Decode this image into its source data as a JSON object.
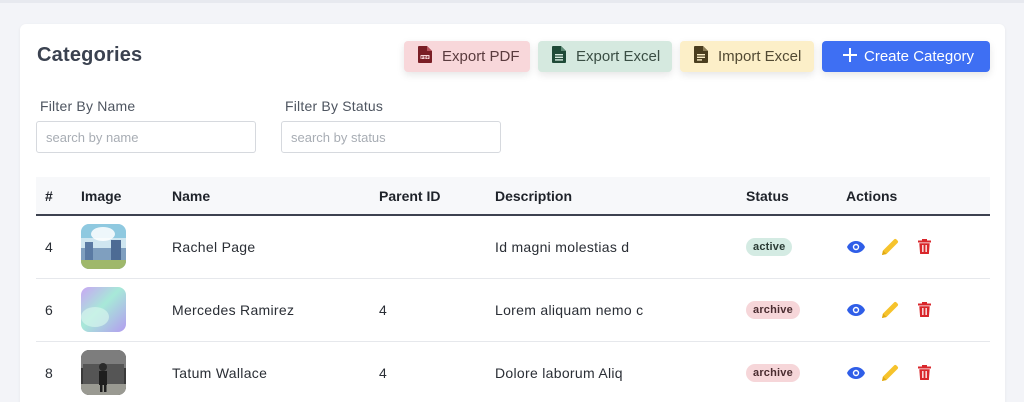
{
  "header": {
    "title": "Categories",
    "buttons": {
      "export_pdf": "Export PDF",
      "export_excel": "Export Excel",
      "import_excel": "Import Excel",
      "create": "Create Category"
    }
  },
  "filters": {
    "name": {
      "label": "Filter By Name",
      "placeholder": "search by name",
      "value": ""
    },
    "status": {
      "label": "Filter By Status",
      "placeholder": "search by status",
      "value": ""
    }
  },
  "table": {
    "columns": [
      "#",
      "Image",
      "Name",
      "Parent ID",
      "Description",
      "Status",
      "Actions"
    ],
    "rows": [
      {
        "id": "4",
        "image": "landscape-thumbnail",
        "name": "Rachel Page",
        "parent_id": "",
        "description": "Id magni molestias d",
        "status": "active"
      },
      {
        "id": "6",
        "image": "gradient-thumbnail",
        "name": "Mercedes Ramirez",
        "parent_id": "4",
        "description": "Lorem aliquam nemo c",
        "status": "archive"
      },
      {
        "id": "8",
        "image": "person-photo-thumbnail",
        "name": "Tatum Wallace",
        "parent_id": "4",
        "description": "Dolore laborum Aliq",
        "status": "archive"
      }
    ]
  },
  "colors": {
    "primary": "#3e6ff3",
    "view_icon": "#2f5ee8",
    "edit_icon": "#f6c32c",
    "delete_icon": "#d9262b",
    "active_badge": "#d4ebe3",
    "archive_badge": "#f6d6d9"
  },
  "icons": {
    "export_pdf": "pdf-file-icon",
    "export_excel": "excel-file-icon",
    "import_excel": "document-file-icon",
    "create": "plus-icon",
    "view": "eye-icon",
    "edit": "pencil-icon",
    "delete": "trash-icon"
  }
}
